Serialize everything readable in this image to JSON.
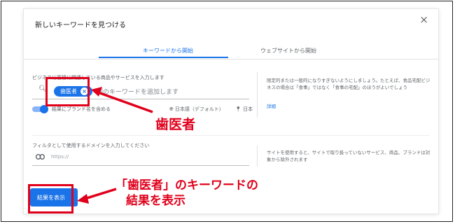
{
  "dialog": {
    "title": "新しいキーワードを見つける",
    "close": "×",
    "tabs": [
      {
        "label": "キーワードから開始",
        "active": true
      },
      {
        "label": "ウェブサイトから開始",
        "active": false
      }
    ]
  },
  "keyword_section": {
    "label": "ビジネスに密接に関連している商品やサービスを入力します",
    "chip": "歯医者",
    "placeholder": "例のキーワードを追加します",
    "toggle_label": "結果にブランド名を含める",
    "language": "日本語（デフォルト）",
    "location": "日本"
  },
  "keyword_help": {
    "text": "限定的または一般的になりすぎないようにしましょう。たとえば、食品宅配ビジネスの場合は「食事」ではなく「食事の宅配」のほうがよいでしょう",
    "link": "詳細"
  },
  "filter_section": {
    "label": "フィルタとして使用するドメインを入力してください",
    "placeholder": "https://",
    "help": "サイトを使用すると、サイトで取り扱っていないサービス、商品、ブランドは対象から除外されます"
  },
  "results_button": "結果を表示",
  "annotations": {
    "keyword_callout": "歯医者",
    "results_line1": "「歯医者」のキーワードの",
    "results_line2": "結果を表示"
  },
  "colors": {
    "accent": "#1a73e8",
    "annotation": "#e0001b"
  }
}
